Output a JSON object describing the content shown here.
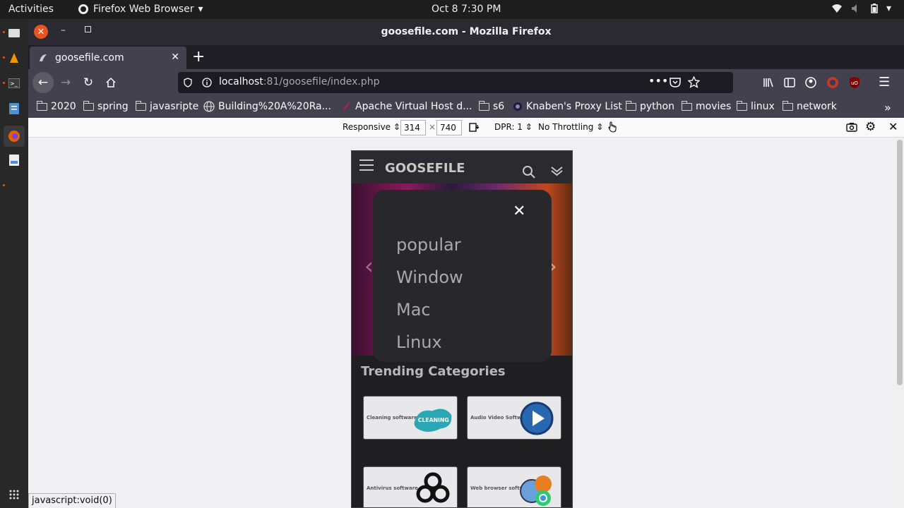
{
  "system": {
    "activities": "Activities",
    "app_menu": "Firefox Web Browser",
    "clock": "Oct 8  7:30 PM"
  },
  "window": {
    "title": "goosefile.com - Mozilla Firefox"
  },
  "tabs": [
    {
      "label": "goosefile.com"
    }
  ],
  "urlbar": {
    "host": "localhost",
    "rest": ":81/goosefile/index.php"
  },
  "bookmarks": [
    {
      "label": "2020",
      "icon": "folder-icon"
    },
    {
      "label": "spring",
      "icon": "folder-icon"
    },
    {
      "label": "javasripte",
      "icon": "folder-icon"
    },
    {
      "label": "Building%20A%20Ra...",
      "icon": "globe-icon"
    },
    {
      "label": "Apache Virtual Host d...",
      "icon": "feather-icon"
    },
    {
      "label": "s6",
      "icon": "folder-icon"
    },
    {
      "label": "Knaben's Proxy List",
      "icon": "site-icon"
    },
    {
      "label": "python",
      "icon": "folder-icon"
    },
    {
      "label": "movies",
      "icon": "folder-icon"
    },
    {
      "label": "linux",
      "icon": "folder-icon"
    },
    {
      "label": "network",
      "icon": "folder-icon"
    }
  ],
  "rdm": {
    "device": "Responsive",
    "width": "314",
    "times": "×",
    "height": "740",
    "dpr": "DPR: 1",
    "throttling": "No Throttling"
  },
  "site": {
    "brand": "GOOSEFILE",
    "menu_items": [
      "popular",
      "Window",
      "Mac",
      "Linux"
    ],
    "close_glyph": "✕",
    "trending_title": "Trending Categories",
    "categories": [
      {
        "label": "Cleaning software",
        "art": "CLEANING"
      },
      {
        "label": "Audio Video Software",
        "art": ""
      },
      {
        "label": "Antivirus software",
        "art": ""
      },
      {
        "label": "Web browser software",
        "art": ""
      }
    ]
  },
  "status": "javascript:void(0)",
  "colors": {
    "accent": "#e95420",
    "topbar": "#1d1d1d",
    "chrome": "#42414d"
  }
}
